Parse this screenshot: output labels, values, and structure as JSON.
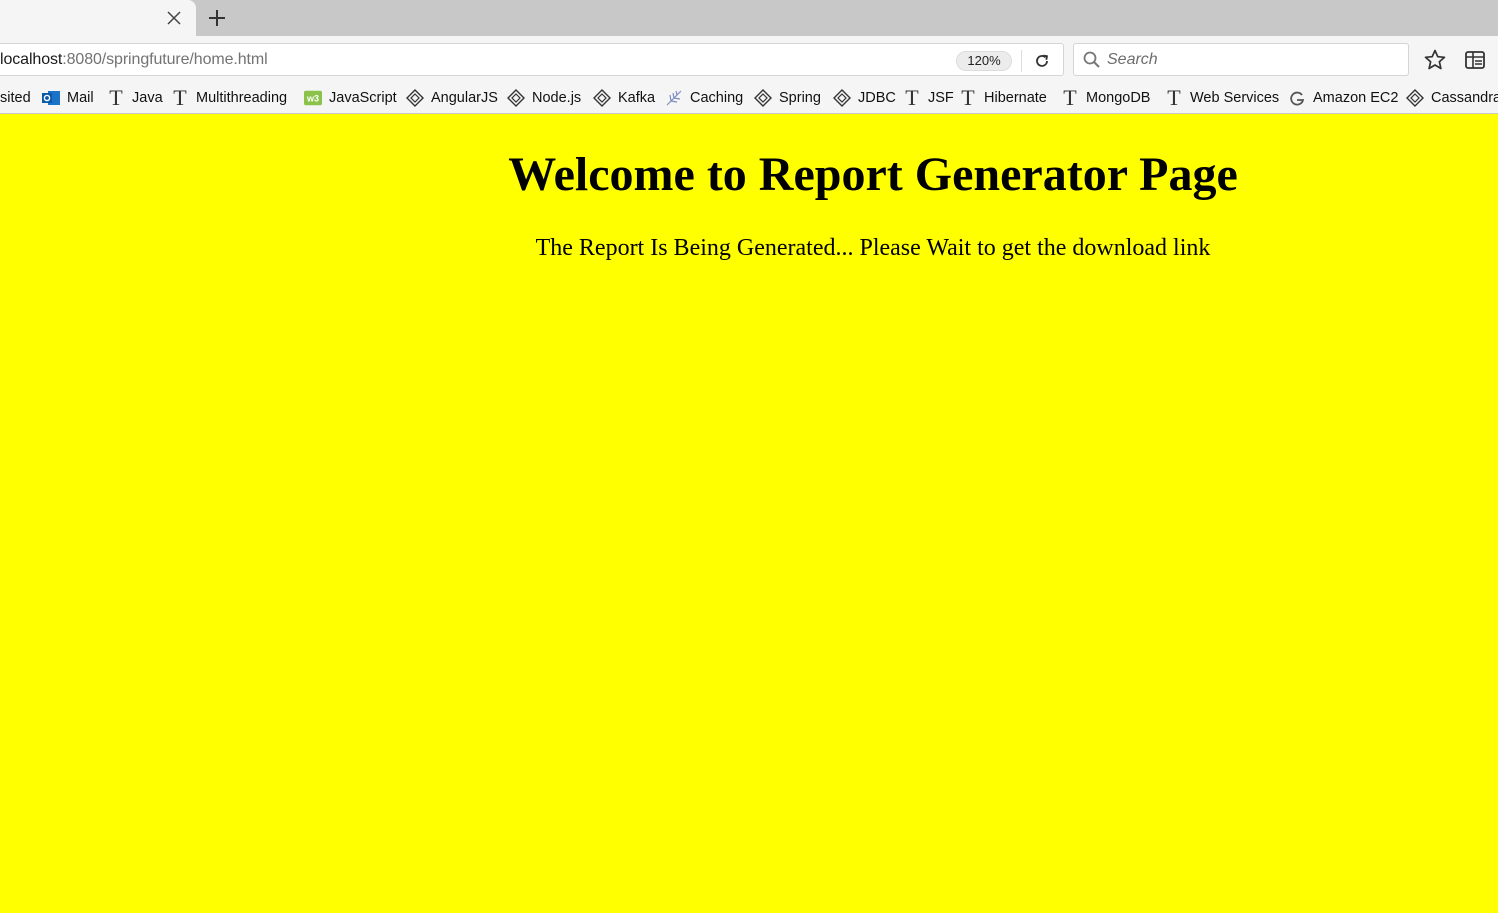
{
  "browser": {
    "url_host": "localhost",
    "url_path": ":8080/springfuture/home.html",
    "zoom": "120%",
    "search_placeholder": "Search"
  },
  "bookmarks": [
    {
      "label": "sited",
      "icon": "none"
    },
    {
      "label": "Mail",
      "icon": "outlook-icon"
    },
    {
      "label": "Java",
      "icon": "t-icon"
    },
    {
      "label": "Multithreading",
      "icon": "t-icon"
    },
    {
      "label": "JavaScript",
      "icon": "w3-icon"
    },
    {
      "label": "AngularJS",
      "icon": "diamond-icon"
    },
    {
      "label": "Node.js",
      "icon": "diamond-icon"
    },
    {
      "label": "Kafka",
      "icon": "diamond-icon"
    },
    {
      "label": "Caching",
      "icon": "feather-icon"
    },
    {
      "label": "Spring",
      "icon": "diamond-icon"
    },
    {
      "label": "JDBC",
      "icon": "diamond-icon"
    },
    {
      "label": "JSF",
      "icon": "t-icon"
    },
    {
      "label": "Hibernate",
      "icon": "t-icon"
    },
    {
      "label": "MongoDB",
      "icon": "t-icon"
    },
    {
      "label": "Web Services",
      "icon": "t-icon"
    },
    {
      "label": "Amazon EC2",
      "icon": "g-icon"
    },
    {
      "label": "Cassandra",
      "icon": "diamond-icon"
    }
  ],
  "page": {
    "heading": "Welcome to Report Generator Page",
    "message": "The Report Is Being Generated... Please Wait to get the download link",
    "background_color": "#ffff00"
  }
}
